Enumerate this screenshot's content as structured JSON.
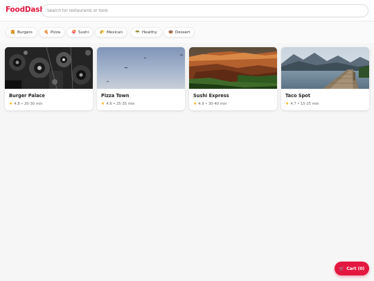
{
  "app": {
    "logo": "FoodDash"
  },
  "search": {
    "placeholder": "Search for restaurants or food",
    "value": ""
  },
  "categories": [
    {
      "icon": "🍔",
      "label": "Burgers"
    },
    {
      "icon": "🍕",
      "label": "Pizza"
    },
    {
      "icon": "🍣",
      "label": "Sushi"
    },
    {
      "icon": "🌮",
      "label": "Mexican"
    },
    {
      "icon": "🥗",
      "label": "Healthy"
    },
    {
      "icon": "🍩",
      "label": "Dessert"
    }
  ],
  "restaurants": [
    {
      "name": "Burger Palace",
      "rating": "4.8",
      "time": "20-30 min",
      "meta": "4.8 • 20-30 min"
    },
    {
      "name": "Pizza Town",
      "rating": "4.6",
      "time": "25-35 min",
      "meta": "4.6 • 25-35 min"
    },
    {
      "name": "Sushi Express",
      "rating": "4.9",
      "time": "30-40 min",
      "meta": "4.9 • 30-40 min"
    },
    {
      "name": "Taco Spot",
      "rating": "4.7",
      "time": "15-25 min",
      "meta": "4.7 • 15-25 min"
    }
  ],
  "cart": {
    "icon": "🛒",
    "label": "Cart (0)"
  },
  "colors": {
    "brand": "#e3173f",
    "star": "#f5b301"
  }
}
